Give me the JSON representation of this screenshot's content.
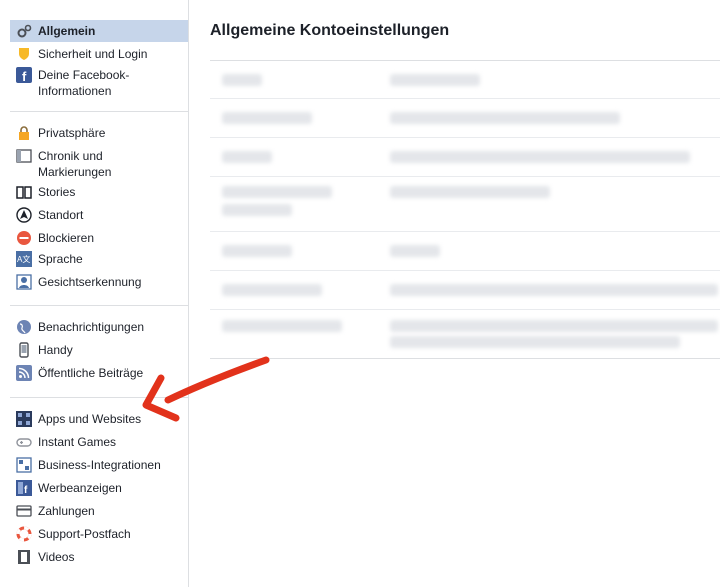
{
  "sidebar": {
    "sections": [
      {
        "items": [
          {
            "label": "Allgemein",
            "icon": "gears-icon",
            "active": true
          },
          {
            "label": "Sicherheit und Login",
            "icon": "shield-icon"
          },
          {
            "label": "Deine Facebook-\nInformationen",
            "icon": "facebook-icon"
          }
        ]
      },
      {
        "items": [
          {
            "label": "Privatsphäre",
            "icon": "lock-icon"
          },
          {
            "label": "Chronik und\nMarkierungen",
            "icon": "timeline-icon"
          },
          {
            "label": "Stories",
            "icon": "book-icon"
          },
          {
            "label": "Standort",
            "icon": "location-icon"
          },
          {
            "label": "Blockieren",
            "icon": "block-icon"
          },
          {
            "label": "Sprache",
            "icon": "language-icon"
          },
          {
            "label": "Gesichtserkennung",
            "icon": "face-icon"
          }
        ]
      },
      {
        "items": [
          {
            "label": "Benachrichtigungen",
            "icon": "globe-icon"
          },
          {
            "label": "Handy",
            "icon": "phone-icon"
          },
          {
            "label": "Öffentliche Beiträge",
            "icon": "rss-icon"
          }
        ]
      },
      {
        "items": [
          {
            "label": "Apps und Websites",
            "icon": "apps-icon"
          },
          {
            "label": "Instant Games",
            "icon": "gamepad-icon"
          },
          {
            "label": "Business-Integrationen",
            "icon": "business-icon"
          },
          {
            "label": "Werbeanzeigen",
            "icon": "ads-icon"
          },
          {
            "label": "Zahlungen",
            "icon": "card-icon"
          },
          {
            "label": "Support-Postfach",
            "icon": "lifebuoy-icon"
          },
          {
            "label": "Videos",
            "icon": "film-icon"
          }
        ]
      }
    ]
  },
  "main": {
    "title": "Allgemeine Kontoeinstellungen"
  },
  "colors": {
    "accent": "#3b5998",
    "active_bg": "#c6d5ea",
    "arrow": "#e2321b"
  }
}
